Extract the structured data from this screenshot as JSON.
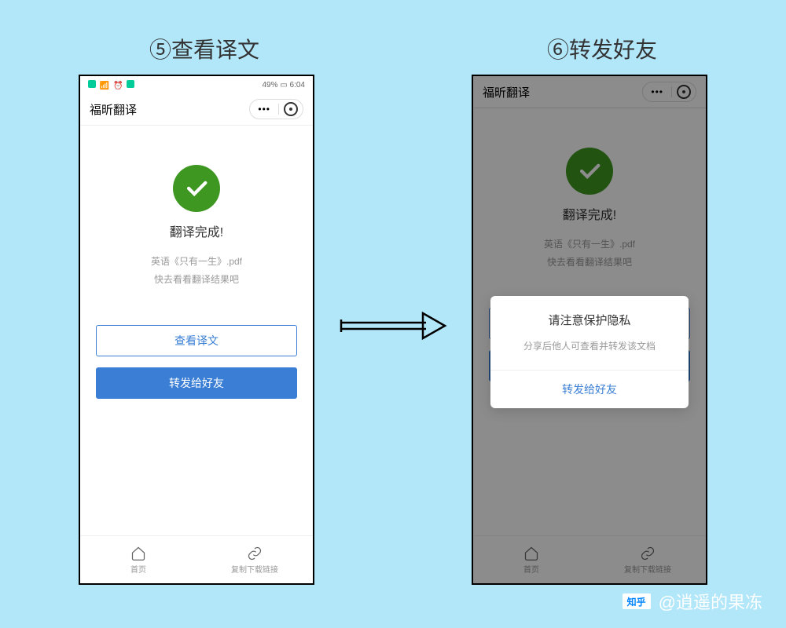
{
  "steps": {
    "left": "⑤查看译文",
    "right": "⑥转发好友"
  },
  "status": {
    "battery": "49%",
    "time": "6:04"
  },
  "app": {
    "title": "福昕翻译"
  },
  "main": {
    "done_title": "翻译完成!",
    "filename": "英语《只有一生》.pdf",
    "prompt": "快去看看翻译结果吧",
    "view_btn": "查看译文",
    "share_btn": "转发给好友"
  },
  "nav": {
    "home": "首页",
    "copy": "复制下载链接"
  },
  "dialog": {
    "title": "请注意保护隐私",
    "sub": "分享后他人可查看并转发该文档",
    "btn": "转发给好友"
  },
  "watermark": {
    "brand": "知乎",
    "author": "@逍遥的果冻"
  }
}
